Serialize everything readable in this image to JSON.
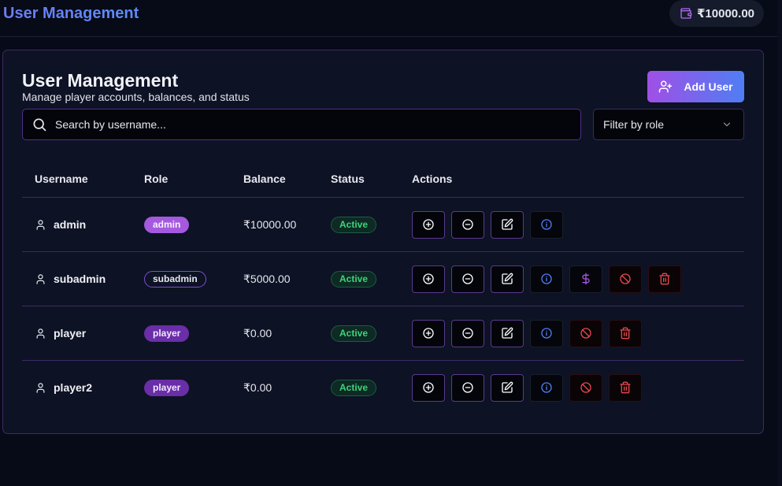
{
  "header": {
    "app_title": "User Management",
    "wallet_balance": "₹10000.00"
  },
  "card": {
    "title": "User Management",
    "subtitle": "Manage player accounts, balances, and status",
    "add_user_label": "Add User"
  },
  "search": {
    "placeholder": "Search by username..."
  },
  "filter": {
    "label": "Filter by role"
  },
  "table": {
    "columns": [
      "Username",
      "Role",
      "Balance",
      "Status",
      "Actions"
    ],
    "rows": [
      {
        "username": "admin",
        "role": "admin",
        "balance": "₹10000.00",
        "status": "Active",
        "actions": [
          "add-balance",
          "deduct-balance",
          "edit",
          "info"
        ]
      },
      {
        "username": "subadmin",
        "role": "subadmin",
        "balance": "₹5000.00",
        "status": "Active",
        "actions": [
          "add-balance",
          "deduct-balance",
          "edit",
          "info",
          "transactions",
          "block",
          "delete"
        ]
      },
      {
        "username": "player",
        "role": "player",
        "balance": "₹0.00",
        "status": "Active",
        "actions": [
          "add-balance",
          "deduct-balance",
          "edit",
          "info",
          "block",
          "delete"
        ]
      },
      {
        "username": "player2",
        "role": "player",
        "balance": "₹0.00",
        "status": "Active",
        "actions": [
          "add-balance",
          "deduct-balance",
          "edit",
          "info",
          "block",
          "delete"
        ]
      }
    ]
  },
  "colors": {
    "background": "#070a17",
    "card": "#0d1224",
    "accent_purple": "#a459de",
    "accent_blue": "#4f7ef4",
    "status_green": "#3fd37a",
    "danger_red": "#e5484d"
  },
  "icons": {
    "wallet": "wallet-icon",
    "add_user": "user-plus-icon",
    "search": "search-icon",
    "filter": "chevron-down-icon",
    "user": "user-icon",
    "add-balance": "plus-circle-icon",
    "deduct-balance": "minus-circle-icon",
    "edit": "edit-icon",
    "info": "info-icon",
    "transactions": "dollar-icon",
    "block": "ban-icon",
    "delete": "trash-icon"
  }
}
